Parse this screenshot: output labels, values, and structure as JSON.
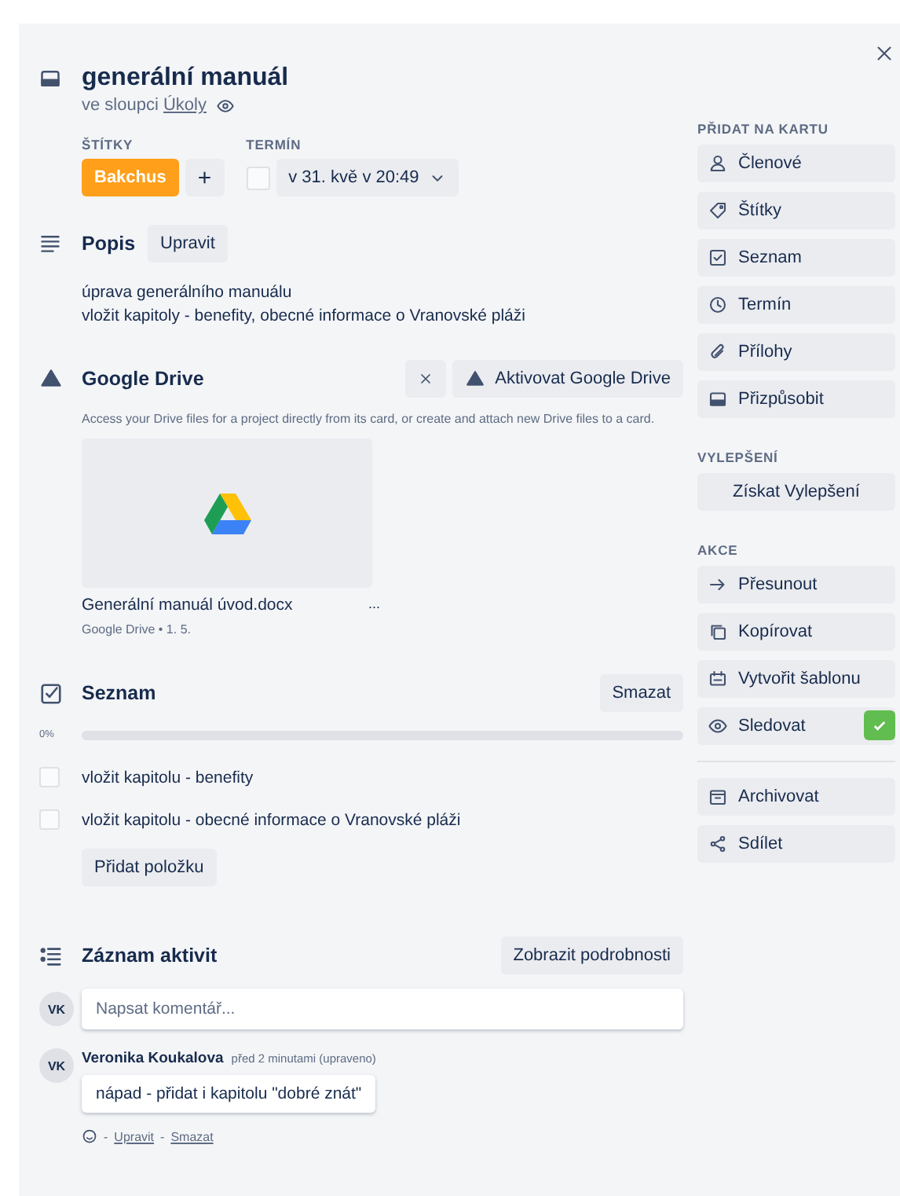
{
  "card": {
    "title": "generální manuál",
    "column_prefix": "ve sloupci",
    "column_link": "Úkoly"
  },
  "labels": {
    "heading": "ŠTÍTKY",
    "items": [
      {
        "text": "Bakchus",
        "color": "#ff9f1a"
      }
    ],
    "add": "+"
  },
  "due": {
    "heading": "TERMÍN",
    "checked": false,
    "value": "v 31. kvě v 20:49"
  },
  "description": {
    "heading": "Popis",
    "edit": "Upravit",
    "lines": [
      "úprava generálního manuálu",
      "vložit kapitoly - benefity, obecné informace o Vranovské pláži"
    ]
  },
  "google_drive": {
    "heading": "Google Drive",
    "activate": "Aktivovat Google Drive",
    "info": "Access your Drive files for a project directly from its card, or create and attach new Drive files to a card.",
    "file": {
      "name": "Generální manuál úvod.docx",
      "more": "...",
      "meta": "Google Drive • 1. 5."
    }
  },
  "checklist": {
    "heading": "Seznam",
    "delete": "Smazat",
    "progress": "0%",
    "level": 0,
    "items": [
      {
        "text": "vložit kapitolu - benefity",
        "checked": false
      },
      {
        "text": "vložit kapitolu - obecné informace o Vranovské pláži",
        "checked": false
      }
    ],
    "add": "Přidat položku"
  },
  "activity": {
    "heading": "Záznam aktivit",
    "details": "Zobrazit podrobnosti",
    "avatar": "VK",
    "placeholder": "Napsat komentář...",
    "comments": [
      {
        "avatar": "VK",
        "author": "Veronika Koukalova",
        "time": "před 2 minutami (upraveno)",
        "text": "nápad - přidat i kapitolu \"dobré znát\"",
        "separator": "-",
        "actions": [
          "Upravit",
          "Smazat"
        ]
      }
    ]
  },
  "sidebar": {
    "sections": [
      {
        "heading": "PŘIDAT NA KARTU",
        "items": [
          {
            "label": "Členové"
          },
          {
            "label": "Štítky"
          },
          {
            "label": "Seznam"
          },
          {
            "label": "Termín"
          },
          {
            "label": "Přílohy"
          },
          {
            "label": "Přizpůsobit"
          }
        ]
      },
      {
        "heading": "VYLEPŠENÍ",
        "items": [
          {
            "label": "Získat Vylepšení"
          }
        ]
      },
      {
        "heading": "AKCE",
        "items": [
          {
            "label": "Přesunout",
            "checked": false
          },
          {
            "label": "Kopírovat",
            "checked": false
          },
          {
            "label": "Vytvořit šablonu",
            "checked": false
          },
          {
            "label": "Sledovat",
            "checked": true
          }
        ]
      },
      {
        "items": [
          {
            "label": "Archivovat"
          },
          {
            "label": "Sdílet"
          }
        ]
      }
    ]
  }
}
